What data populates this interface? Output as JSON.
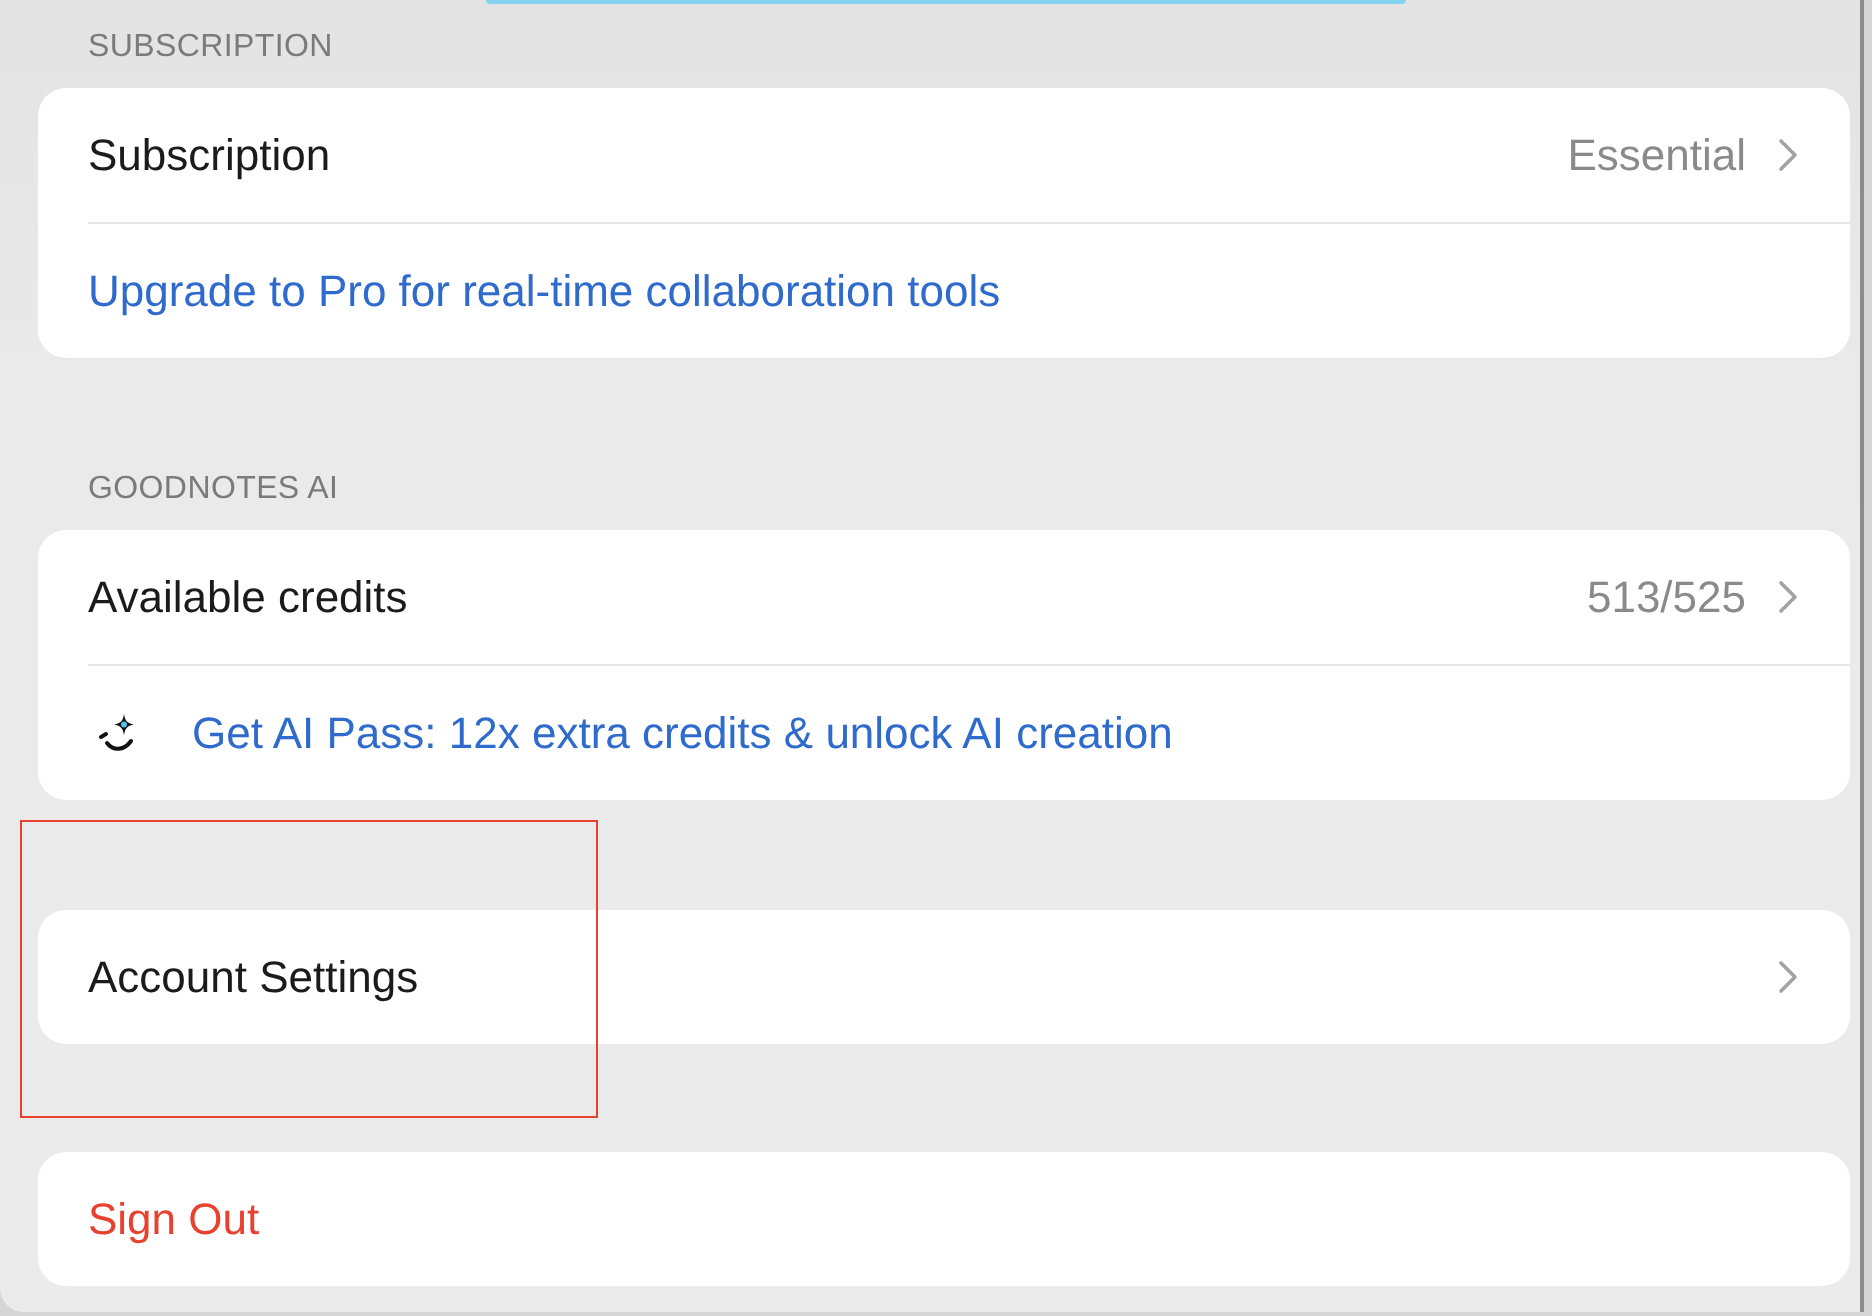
{
  "sections": [
    {
      "header": "SUBSCRIPTION",
      "rows": [
        {
          "kind": "nav",
          "label": "Subscription",
          "value": "Essential",
          "highlighted": false
        },
        {
          "kind": "link",
          "label": "Upgrade to Pro for real-time collaboration tools",
          "highlighted": false
        }
      ]
    },
    {
      "header": "GOODNOTES AI",
      "rows": [
        {
          "kind": "nav",
          "label": "Available credits",
          "value": "513/525",
          "highlighted": false
        },
        {
          "kind": "promo",
          "label": "Get AI Pass: 12x extra credits & unlock AI creation",
          "highlighted": false
        }
      ]
    },
    {
      "rows": [
        {
          "kind": "nav",
          "label": "Account Settings",
          "highlighted": true
        }
      ]
    },
    {
      "rows": [
        {
          "kind": "destructive",
          "label": "Sign Out",
          "highlighted": false
        }
      ]
    }
  ]
}
